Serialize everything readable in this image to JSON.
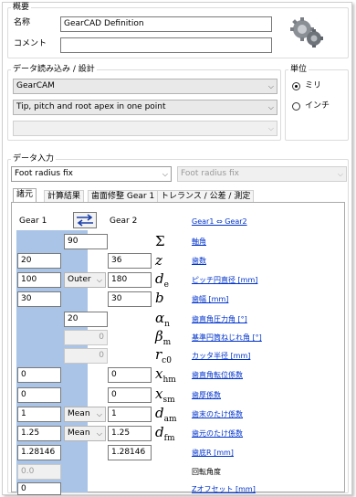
{
  "overview": {
    "legend": "概要",
    "name_label": "名称",
    "name_value": "GearCAD Definition",
    "comment_label": "コメント",
    "comment_value": ""
  },
  "data_import": {
    "legend": "データ読み込み / 設計",
    "source_value": "GearCAM",
    "method_value": "Tip, pitch and root apex in one point",
    "third_value": ""
  },
  "units": {
    "legend": "単位",
    "mm_label": "ミリ",
    "inch_label": "インチ",
    "selected": "ミリ"
  },
  "data_input": {
    "legend": "データ入力",
    "foot_left": "Foot radius fix",
    "foot_right": "Foot radius fix"
  },
  "tabs": [
    "諸元",
    "計算結果",
    "歯面修整 Gear 1",
    "トレランス / 公差 / 測定"
  ],
  "table": {
    "gear1_label": "Gear 1",
    "gear2_label": "Gear 2",
    "swap_link": "Gear1 ⇔ Gear2",
    "rows": [
      {
        "g1": "",
        "mode": "",
        "g2": "90",
        "sym": "Σ",
        "sub": "",
        "link": "軸角"
      },
      {
        "g1": "20",
        "mode": "",
        "g2": "36",
        "sym": "z",
        "sub": "",
        "link": "歯数"
      },
      {
        "g1": "100",
        "mode": "Outer",
        "g2": "180",
        "sym": "d",
        "sub": "e",
        "link": "ピッチ円直径 [mm]"
      },
      {
        "g1": "30",
        "mode": "",
        "g2": "30",
        "sym": "b",
        "sub": "",
        "link": "歯幅 [mm]"
      },
      {
        "g1": "",
        "mode": "",
        "g2": "20",
        "sym": "α",
        "sub": "n",
        "link": "歯直角圧力角 [°]"
      },
      {
        "g1": "",
        "mode": "",
        "g2": "0",
        "sym": "β",
        "sub": "m",
        "link": "基準円筒ねじれ角 [°]"
      },
      {
        "g1": "",
        "mode": "",
        "g2": "0",
        "sym": "r",
        "sub": "c0",
        "link": "カッタ半径 [mm]"
      },
      {
        "g1": "0",
        "mode": "",
        "g2": "0",
        "sym": "x",
        "sub": "hm",
        "link": "歯直角転位係数"
      },
      {
        "g1": "0",
        "mode": "",
        "g2": "0",
        "sym": "x",
        "sub": "sm",
        "link": "歯厚係数"
      },
      {
        "g1": "1",
        "mode": "Mean",
        "g2": "1",
        "sym": "d",
        "sub": "am",
        "link": "歯末のたけ係数"
      },
      {
        "g1": "1.25",
        "mode": "Mean",
        "g2": "1.25",
        "sym": "d",
        "sub": "fm",
        "link": "歯元のたけ係数"
      },
      {
        "g1": "1.28146",
        "mode": "",
        "g2": "1.28146",
        "sym": "",
        "sub": "",
        "link": "歯底R [mm]"
      },
      {
        "g1": "0.0",
        "mode": "",
        "g2": "",
        "sym": "",
        "sub": "",
        "link": "回転角度"
      },
      {
        "g1": "0",
        "mode": "",
        "g2": "",
        "sym": "",
        "sub": "",
        "link": "Zオフセット [mm]"
      }
    ]
  },
  "colors": {
    "column_blue": "#a9c4e6",
    "link_blue": "#0033cc"
  },
  "icons": {
    "logo": "gear-pair-logo",
    "swap": "swap-arrows-icon"
  }
}
